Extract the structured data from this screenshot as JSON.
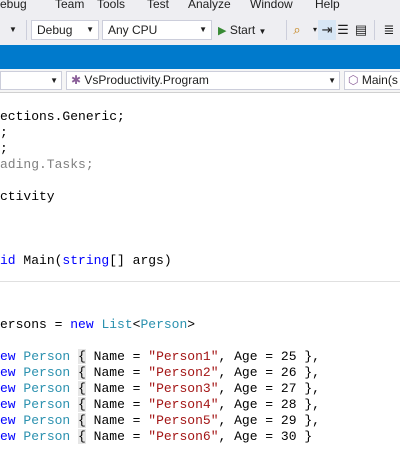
{
  "menu": [
    "ebug",
    "Team",
    "Tools",
    "Test",
    "Analyze",
    "Window",
    "Help"
  ],
  "toolbar": {
    "config": "Debug",
    "platform": "Any CPU",
    "start_label": "Start"
  },
  "nav": {
    "class_combo": "VsProductivity.Program",
    "member_combo": "Main(s"
  },
  "code": {
    "l1": "ections.Generic;",
    "l2": ";",
    "l3": ";",
    "l4": "ading.Tasks;",
    "l5": "ctivity",
    "l6_kw": "id",
    "l6_name": " Main(",
    "l6_type": "string",
    "l6_rest": "[] args)",
    "l7_a": "ersons = ",
    "l7_kw": "new",
    "l7_b": " ",
    "l7_type": "List",
    "l7_lt": "<",
    "l7_type2": "Person",
    "l7_gt": ">",
    "rows": [
      {
        "kw": "ew",
        "type": "Person",
        "brace": "{",
        "a": " Name = ",
        "s": "\"Person1\"",
        "b": ", Age = 25",
        "end": "},"
      },
      {
        "kw": "ew",
        "type": "Person",
        "brace": "{",
        "a": " Name = ",
        "s": "\"Person2\"",
        "b": ", Age = 26",
        "end": "},"
      },
      {
        "kw": "ew",
        "type": "Person",
        "brace": "{",
        "a": " Name = ",
        "s": "\"Person3\"",
        "b": ", Age = 27",
        "end": "},"
      },
      {
        "kw": "ew",
        "type": "Person",
        "brace": "{",
        "a": " Name = ",
        "s": "\"Person4\"",
        "b": ", Age = 28",
        "end": "},"
      },
      {
        "kw": "ew",
        "type": "Person",
        "brace": "{",
        "a": " Name = ",
        "s": "\"Person5\"",
        "b": ", Age = 29",
        "end": "},"
      },
      {
        "kw": "ew",
        "type": "Person",
        "brace": "{",
        "a": " Name = ",
        "s": "\"Person6\"",
        "b": ", Age = 30",
        "end": "}"
      }
    ]
  }
}
